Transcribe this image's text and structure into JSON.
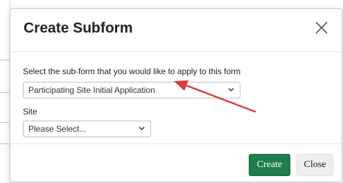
{
  "modal": {
    "title": "Create Subform",
    "close_icon": "close-x-icon"
  },
  "form": {
    "subform_label": "Select the sub-form that you would like to apply to this form",
    "subform_value": "Participating Site Initial Application",
    "site_label": "Site",
    "site_value": "Please Select..."
  },
  "footer": {
    "create_label": "Create",
    "close_label": "Close"
  },
  "colors": {
    "primary_button": "#1e7d4a",
    "annotation_arrow": "#e03a3a"
  },
  "annotation": {
    "icon": "red-arrow-icon"
  }
}
